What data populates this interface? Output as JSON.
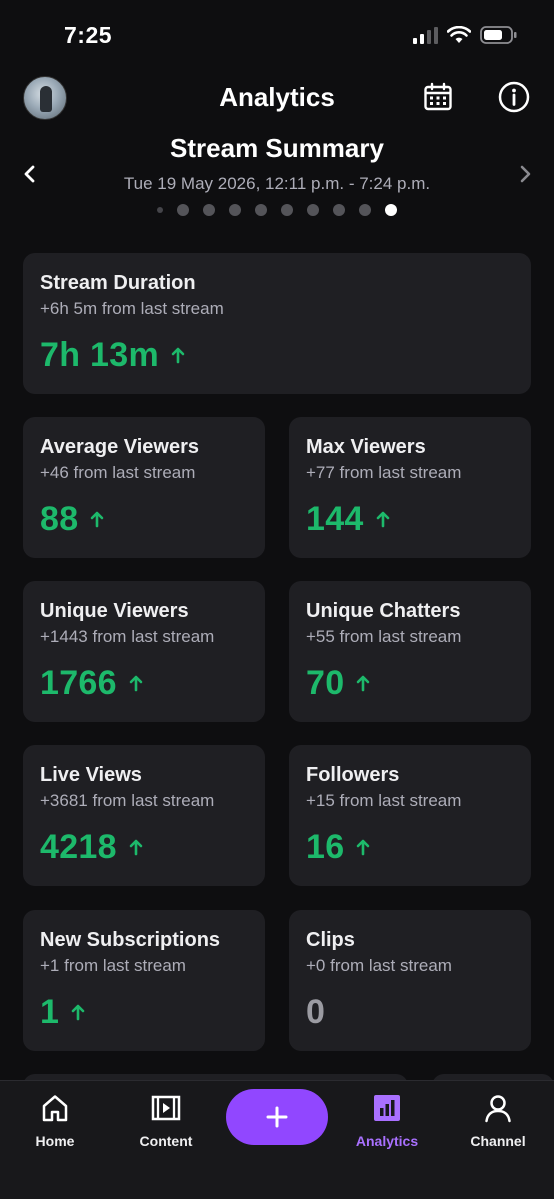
{
  "status_bar": {
    "time": "7:25"
  },
  "header": {
    "title": "Analytics"
  },
  "summary": {
    "title": "Stream Summary",
    "date_range": "Tue 19 May 2026, 12:11 p.m. - 7:24 p.m.",
    "page_count": 10,
    "active_page": 10
  },
  "cards": {
    "stream_duration": {
      "title": "Stream Duration",
      "subtitle": "+6h 5m from last stream",
      "value": "7h 13m",
      "trend": "up"
    },
    "average_viewers": {
      "title": "Average Viewers",
      "subtitle": "+46 from last stream",
      "value": "88",
      "trend": "up"
    },
    "max_viewers": {
      "title": "Max Viewers",
      "subtitle": "+77 from last stream",
      "value": "144",
      "trend": "up"
    },
    "unique_viewers": {
      "title": "Unique Viewers",
      "subtitle": "+1443 from last stream",
      "value": "1766",
      "trend": "up"
    },
    "unique_chatters": {
      "title": "Unique Chatters",
      "subtitle": "+55 from last stream",
      "value": "70",
      "trend": "up"
    },
    "live_views": {
      "title": "Live Views",
      "subtitle": "+3681 from last stream",
      "value": "4218",
      "trend": "up"
    },
    "followers": {
      "title": "Followers",
      "subtitle": "+15 from last stream",
      "value": "16",
      "trend": "up"
    },
    "new_subscriptions": {
      "title": "New Subscriptions",
      "subtitle": "+1 from last stream",
      "value": "1",
      "trend": "up"
    },
    "clips": {
      "title": "Clips",
      "subtitle": "+0 from last stream",
      "value": "0",
      "trend": "none"
    }
  },
  "bottom_nav": {
    "home": "Home",
    "content": "Content",
    "create_symbol": "+",
    "analytics": "Analytics",
    "channel": "Channel",
    "active": "analytics"
  },
  "colors": {
    "background": "#0e0e10",
    "card": "#1f1f23",
    "positive": "#1db96b",
    "accent": "#9147ff",
    "accent_text": "#a970ff"
  }
}
